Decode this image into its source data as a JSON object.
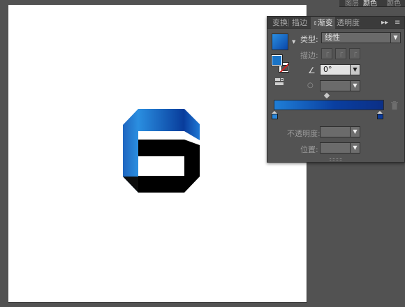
{
  "top_tabs": [
    "图层",
    "颜色",
    "颜色"
  ],
  "panel": {
    "tabs": [
      "变换",
      "描边",
      "渐变",
      "透明度"
    ],
    "active_tab": "渐变",
    "menu_icon": "panel-menu-icon",
    "type_label": "类型:",
    "type_value": "线性",
    "stroke_label": "描边:",
    "angle_value": "0°",
    "opacity_label": "不透明度:",
    "location_label": "位置:",
    "opacity_value": "",
    "location_value": ""
  },
  "gradient": {
    "stops": [
      {
        "color": "#2b86d9",
        "position": 0
      },
      {
        "color": "#0b3a9a",
        "position": 100
      }
    ]
  },
  "colors": {
    "accent_start": "#2b8fe0",
    "accent_end": "#0a3f9f",
    "logo_dark": "#000000"
  }
}
